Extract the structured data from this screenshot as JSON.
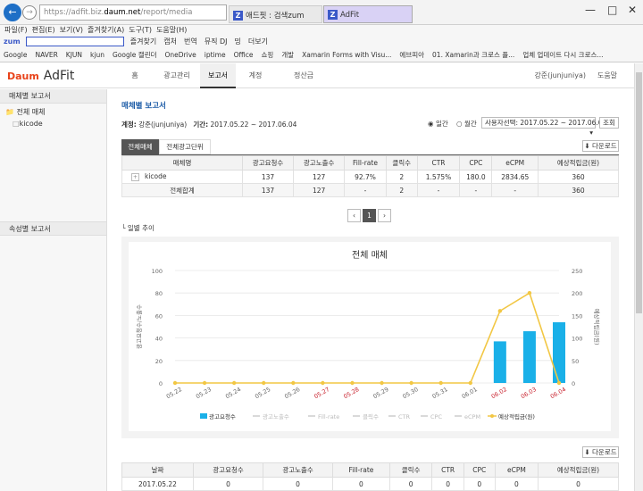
{
  "browser": {
    "url_prefix": "https://adfit.biz.",
    "url_domain": "daum.net",
    "url_path": "/report/media",
    "tab1": "애드핏 : 검색zum",
    "tab2": "AdFit"
  },
  "menu": [
    "파일(F)",
    "편집(E)",
    "보기(V)",
    "즐겨찾기(A)",
    "도구(T)",
    "도움말(H)"
  ],
  "zumbar": {
    "logo": "zum",
    "items": [
      "즐겨찾기",
      "캡처",
      "번역",
      "뮤직 DJ",
      "밍",
      "더보기"
    ]
  },
  "favorites": [
    "Google",
    "NAVER",
    "KJUN",
    "kjun",
    "Google 캘린더",
    "OneDrive",
    "iptime",
    "Office",
    "쇼핑",
    "개발",
    "Xamarin Forms with Visu...",
    "에브피아",
    "01. Xamarin과 크로스 플...",
    "업체 업데이트 다시 크로스..."
  ],
  "header": {
    "logo_daum": "Daum",
    "logo_adfit": "AdFit",
    "nav": [
      "홈",
      "광고관리",
      "보고서",
      "계정",
      "정산금"
    ],
    "user": "강준(junjuniya)",
    "help": "도움말"
  },
  "sidebar": {
    "section1": "매체별 보고서",
    "tree_root": "전체 매체",
    "tree_child": "kicode",
    "section2": "속성별 보고서"
  },
  "report": {
    "title": "매체별 보고서",
    "account_label": "계정:",
    "account": "강준(junjuniya)",
    "period_label": "기간:",
    "period": "2017.05.22 ~ 2017.06.04",
    "radio_daily": "일간",
    "radio_monthly": "월간",
    "select": "사용자선택: 2017.05.22 ~ 2017.06.04",
    "search": "조회",
    "tab_all": "전체매체",
    "tab_unit": "전체광고단위",
    "download": "다운로드",
    "page": "1",
    "trend_label": "일별 추이"
  },
  "table1": {
    "headers": [
      "매체명",
      "광고요청수",
      "광고노출수",
      "Fill-rate",
      "클릭수",
      "CTR",
      "CPC",
      "eCPM",
      "예상적립금(원)"
    ],
    "rows": [
      [
        "kicode",
        "137",
        "127",
        "92.7%",
        "2",
        "1.575%",
        "180.0",
        "2834.65",
        "360"
      ],
      [
        "전체합계",
        "137",
        "127",
        "-",
        "2",
        "-",
        "-",
        "-",
        "360"
      ]
    ]
  },
  "table2": {
    "headers": [
      "날짜",
      "광고요청수",
      "광고노출수",
      "Fill-rate",
      "클릭수",
      "CTR",
      "CPC",
      "eCPM",
      "예상적립금(원)"
    ],
    "rows": [
      [
        "2017.05.22",
        "0",
        "0",
        "0",
        "0",
        "0",
        "0",
        "0",
        "0"
      ]
    ]
  },
  "chart_data": {
    "type": "bar",
    "title": "전체 매체",
    "categories": [
      "05.22",
      "05.23",
      "05.24",
      "05.25",
      "05.26",
      "05.27",
      "05.28",
      "05.29",
      "05.30",
      "05.31",
      "06.01",
      "06.02",
      "06.03",
      "06.04"
    ],
    "series": [
      {
        "name": "광고요청수",
        "type": "bar",
        "axis": "left",
        "values": [
          0,
          0,
          0,
          0,
          0,
          0,
          0,
          0,
          0,
          0,
          0,
          37,
          46,
          54
        ]
      },
      {
        "name": "예상적립금(원)",
        "type": "line",
        "axis": "right",
        "values": [
          0,
          0,
          0,
          0,
          0,
          0,
          0,
          0,
          0,
          0,
          0,
          160,
          200,
          0
        ]
      }
    ],
    "legend": [
      "광고요청수",
      "광고노출수",
      "Fill-rate",
      "클릭수",
      "CTR",
      "CPC",
      "eCPM",
      "예상적립금(원)"
    ],
    "ylabel_left": "광고요청수/노출수",
    "ylabel_right": "예상적립금(원)",
    "ylim_left": [
      0,
      100
    ],
    "ylim_right": [
      0,
      250
    ],
    "yticks_left": [
      "0",
      "20",
      "40",
      "60",
      "80",
      "100"
    ],
    "yticks_right": [
      "0",
      "50",
      "100",
      "150",
      "200",
      "250"
    ],
    "weekend_red": [
      "05.27",
      "05.28",
      "06.02",
      "06.03",
      "06.04"
    ],
    "legend_position": "bottom",
    "grid": true
  },
  "colors": {
    "bar": "#1ab0e8",
    "line": "#f2c744",
    "accent": "#1a5aa6",
    "weekend": "#c8202c"
  }
}
